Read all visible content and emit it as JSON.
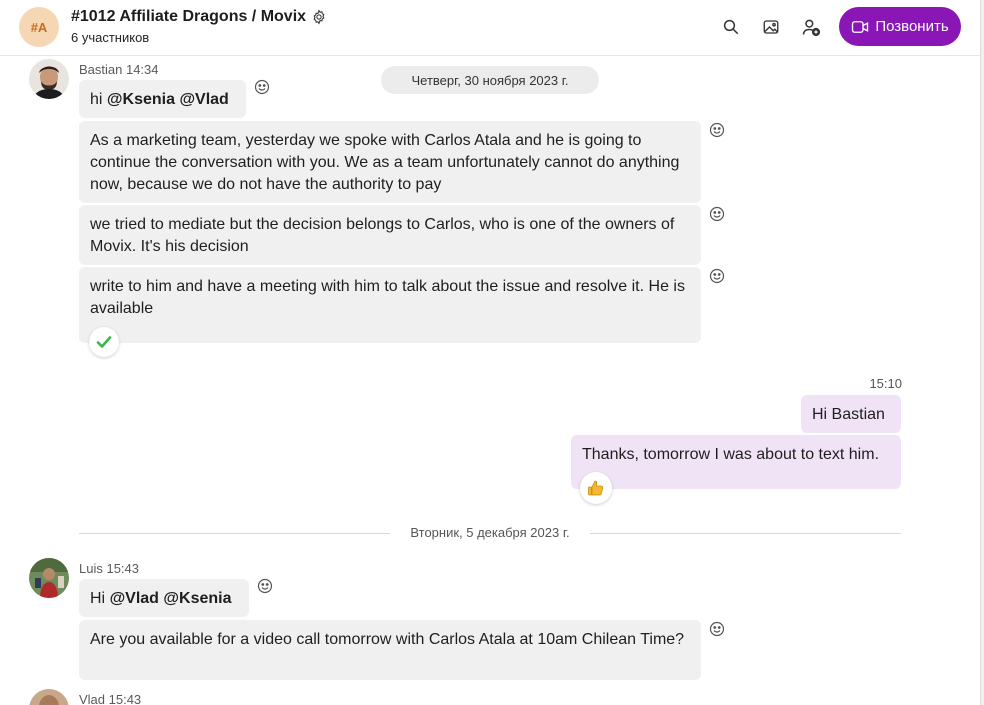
{
  "header": {
    "avatar_initials": "#A",
    "title": "#1012 Affiliate Dragons / Movix",
    "subtitle": "6 участников",
    "call_label": "Позвонить",
    "accent_color": "#8a16b5",
    "icons": [
      "search-icon",
      "gallery-icon",
      "add-person-icon",
      "video-call-icon",
      "gear-icon"
    ]
  },
  "dates": {
    "first": "Четверг, 30 ноября 2023 г.",
    "second": "Вторник, 5 декабря 2023 г."
  },
  "messages": [
    {
      "sender": "Bastian 14:34",
      "parts": [
        {
          "pre": "hi ",
          "mention1": "@Ksenia",
          "sep": " ",
          "mention2": "@Vlad"
        },
        {
          "text": "As a marketing team, yesterday we spoke with Carlos Atala and he is going to continue the conversation with you. We as a team unfortunately cannot do anything now, because we do not have the authority to pay"
        },
        {
          "text": "we tried to mediate but the decision belongs to Carlos, who is one of the owners of Movix. It's his decision"
        },
        {
          "text": "write to him and have a meeting with him to talk about the issue and resolve it. He is available"
        }
      ]
    },
    {
      "time": "15:10",
      "own": true,
      "parts": [
        {
          "text": "Hi Bastian"
        },
        {
          "text": "Thanks, tomorrow I was about to text him."
        }
      ]
    },
    {
      "sender": "Luis 15:43",
      "parts": [
        {
          "pre": "Hi ",
          "mention1": "@Vlad",
          "sep": " ",
          "mention2": "@Ksenia"
        },
        {
          "text": "Are you available for a video call tomorrow with Carlos Atala at 10am Chilean Time?"
        }
      ]
    },
    {
      "sender": "Vlad 15:43"
    }
  ]
}
